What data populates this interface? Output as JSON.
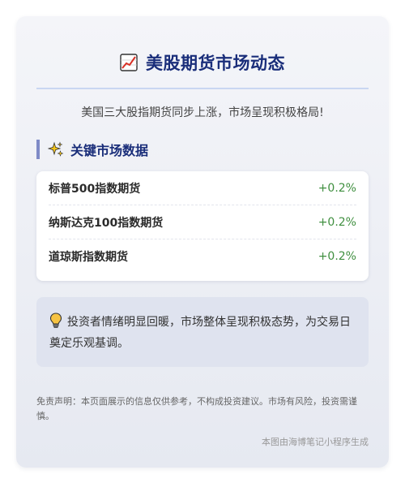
{
  "header": {
    "icon": "chart-increasing-icon",
    "title": "美股期货市场动态"
  },
  "subtitle": "美国三大股指期货同步上涨，市场呈现积极格局!",
  "section": {
    "icon": "sparkles-icon",
    "title": "关键市场数据"
  },
  "market_data": [
    {
      "name": "标普500指数期货",
      "change": "+0.2%"
    },
    {
      "name": "纳斯达克100指数期货",
      "change": "+0.2%"
    },
    {
      "name": "道琼斯指数期货",
      "change": "+0.2%"
    }
  ],
  "insight": {
    "icon": "light-bulb-icon",
    "text": "投资者情绪明显回暖，市场整体呈现积极态势，为交易日奠定乐观基调。"
  },
  "disclaimer": "免责声明：本页面展示的信息仅供参考，不构成投资建议。市场有风险，投资需谨慎。",
  "footer": "本图由海博笔记小程序生成",
  "colors": {
    "title": "#1a2e7a",
    "positive": "#3f8f3f",
    "accent_bar": "#7f8bc7"
  }
}
